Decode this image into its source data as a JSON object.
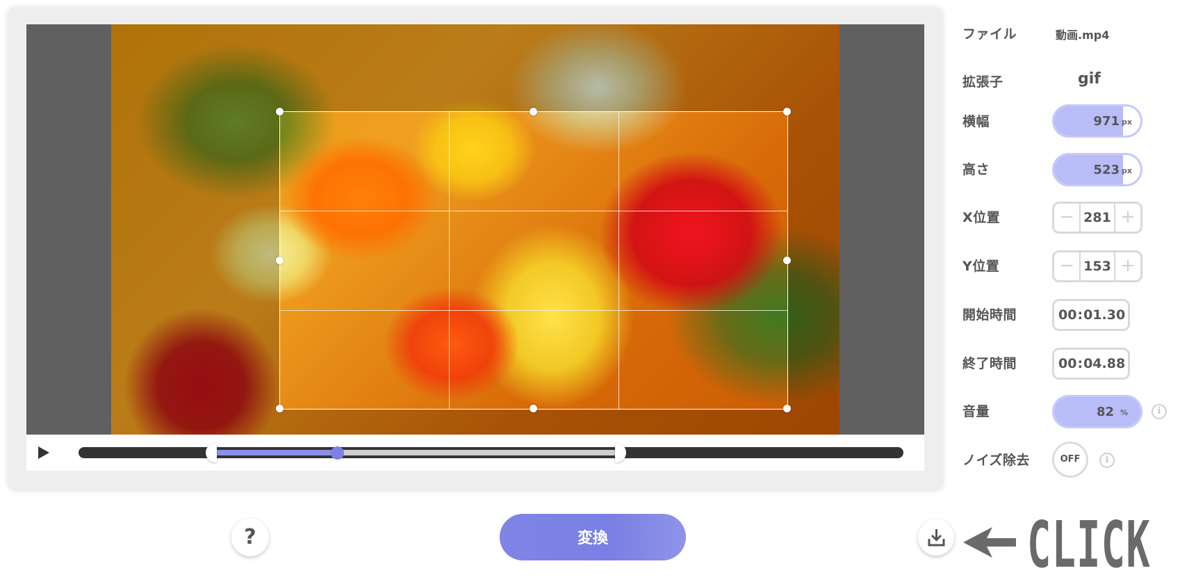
{
  "preview": {
    "crop_grid": true
  },
  "player": {
    "play_icon": "play-icon",
    "trim_start_fraction": 0.166,
    "trim_end_fraction": 0.652,
    "playhead_fraction": 0.313
  },
  "settings": {
    "file_label": "ファイル",
    "file_value": "動画.mp4",
    "ext_label": "拡張子",
    "ext_value": "gif",
    "width_label": "横幅",
    "width_value": "971",
    "width_unit": "px",
    "height_label": "高さ",
    "height_value": "523",
    "height_unit": "px",
    "x_label": "X位置",
    "x_value": "281",
    "y_label": "Y位置",
    "y_value": "153",
    "start_label": "開始時間",
    "start_min": "00",
    "start_sec": "01.30",
    "end_label": "終了時間",
    "end_min": "00",
    "end_sec": "04.88",
    "time_separator": ":",
    "volume_label": "音量",
    "volume_value": "82",
    "volume_unit": "%",
    "noise_label": "ノイズ除去",
    "noise_value": "OFF",
    "minus_glyph": "−",
    "plus_glyph": "+",
    "info_glyph": "i"
  },
  "bottom": {
    "help_label": "?",
    "convert_label": "変換",
    "download_icon": "download-icon",
    "click_label": "CLICK"
  },
  "colors": {
    "accent": "#7d82e2",
    "pill_fill": "#b8bcf7",
    "track_dark": "#333333"
  }
}
